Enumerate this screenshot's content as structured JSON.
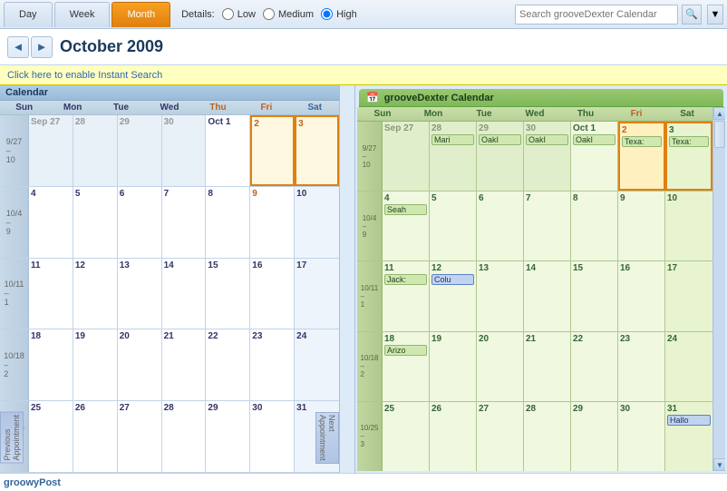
{
  "toolbar": {
    "tabs": [
      "Day",
      "Week",
      "Month"
    ],
    "active_tab": "Month",
    "details_label": "Details:",
    "detail_levels": [
      "Low",
      "Medium",
      "High"
    ],
    "search_placeholder": "Search grooveDexter Calendar"
  },
  "nav": {
    "month_title": "October 2009",
    "prev_label": "◄",
    "next_label": "►"
  },
  "instant_search": "Click here to enable Instant Search",
  "left_calendar": {
    "header": "Calendar",
    "days_of_week": [
      "Sun",
      "Mon",
      "Tue",
      "Wed",
      "Thu",
      "Fri",
      "Sat"
    ],
    "weeks": [
      {
        "label": "9/27 – 10",
        "days": [
          {
            "num": "Sep 27",
            "other": true
          },
          {
            "num": "28",
            "other": true
          },
          {
            "num": "29",
            "other": true
          },
          {
            "num": "30",
            "other": true
          },
          {
            "num": "Oct 1",
            "first": true
          },
          {
            "num": "2",
            "today": true
          },
          {
            "num": "3",
            "weekend": true
          }
        ]
      },
      {
        "label": "10/4 – 9",
        "days": [
          {
            "num": "4"
          },
          {
            "num": "5"
          },
          {
            "num": "6"
          },
          {
            "num": "7"
          },
          {
            "num": "8"
          },
          {
            "num": "9",
            "today2": true
          },
          {
            "num": "10",
            "weekend": true
          }
        ]
      },
      {
        "label": "10/11 – 1",
        "days": [
          {
            "num": "11"
          },
          {
            "num": "12"
          },
          {
            "num": "13"
          },
          {
            "num": "14"
          },
          {
            "num": "15"
          },
          {
            "num": "16"
          },
          {
            "num": "17",
            "weekend": true
          }
        ]
      },
      {
        "label": "10/18 – 2",
        "days": [
          {
            "num": "18"
          },
          {
            "num": "19"
          },
          {
            "num": "20"
          },
          {
            "num": "21"
          },
          {
            "num": "22"
          },
          {
            "num": "23"
          },
          {
            "num": "24",
            "weekend": true
          }
        ]
      },
      {
        "label": "10/25 – 3",
        "days": [
          {
            "num": "25"
          },
          {
            "num": "26"
          },
          {
            "num": "27"
          },
          {
            "num": "28"
          },
          {
            "num": "29"
          },
          {
            "num": "30"
          },
          {
            "num": "31",
            "weekend": true
          }
        ]
      }
    ]
  },
  "right_calendar": {
    "header": "grooveDexter Calendar",
    "days_of_week": [
      "Sun",
      "Mon",
      "Tue",
      "Wed",
      "Thu",
      "Fri",
      "Sat"
    ],
    "weeks": [
      {
        "label": "9/27 – 10",
        "days": [
          {
            "num": "Sep 27",
            "other": true,
            "events": []
          },
          {
            "num": "28",
            "other": true,
            "events": [
              "Mari"
            ]
          },
          {
            "num": "29",
            "other": true,
            "events": [
              "OakI"
            ]
          },
          {
            "num": "30",
            "other": true,
            "events": [
              "OakI"
            ]
          },
          {
            "num": "Oct 1",
            "first": true,
            "events": [
              "OakI"
            ]
          },
          {
            "num": "2",
            "today": true,
            "events": [
              "Texa:"
            ]
          },
          {
            "num": "3",
            "weekend": true,
            "events": [
              "Texa:"
            ]
          }
        ]
      },
      {
        "label": "10/4 – 9",
        "days": [
          {
            "num": "4",
            "events": [
              "Seah"
            ]
          },
          {
            "num": "5",
            "events": []
          },
          {
            "num": "6",
            "events": []
          },
          {
            "num": "7",
            "events": []
          },
          {
            "num": "8",
            "events": []
          },
          {
            "num": "9",
            "events": []
          },
          {
            "num": "10",
            "weekend": true,
            "events": []
          }
        ]
      },
      {
        "label": "10/11 – 1",
        "days": [
          {
            "num": "11",
            "events": [
              "Jack:"
            ]
          },
          {
            "num": "12",
            "events": [
              "Colu"
            ]
          },
          {
            "num": "13",
            "events": []
          },
          {
            "num": "14",
            "events": []
          },
          {
            "num": "15",
            "events": []
          },
          {
            "num": "16",
            "events": []
          },
          {
            "num": "17",
            "weekend": true,
            "events": []
          }
        ]
      },
      {
        "label": "10/18 – 2",
        "days": [
          {
            "num": "18",
            "events": [
              "Arizo"
            ]
          },
          {
            "num": "19",
            "events": []
          },
          {
            "num": "20",
            "events": []
          },
          {
            "num": "21",
            "events": []
          },
          {
            "num": "22",
            "events": []
          },
          {
            "num": "23",
            "events": []
          },
          {
            "num": "24",
            "weekend": true,
            "events": []
          }
        ]
      },
      {
        "label": "10/25 – 3",
        "days": [
          {
            "num": "25",
            "events": []
          },
          {
            "num": "26",
            "events": []
          },
          {
            "num": "27",
            "events": []
          },
          {
            "num": "28",
            "events": []
          },
          {
            "num": "29",
            "events": []
          },
          {
            "num": "30",
            "events": []
          },
          {
            "num": "31",
            "weekend": true,
            "events": [
              "Hallo"
            ]
          }
        ]
      }
    ]
  },
  "footer": {
    "brand": "groowyPost"
  }
}
